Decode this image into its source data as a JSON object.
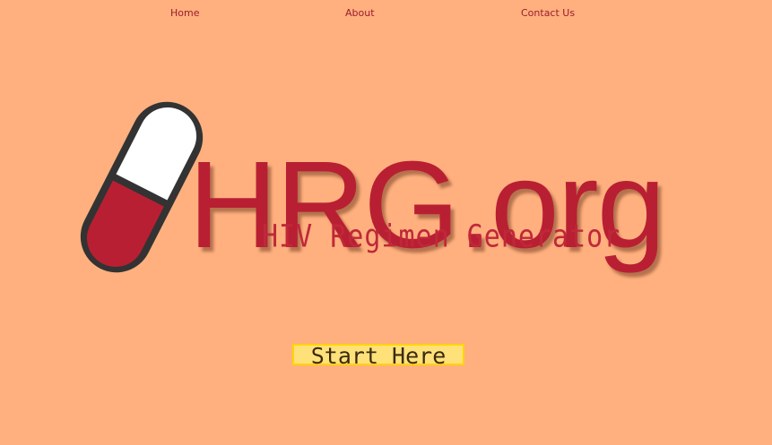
{
  "nav": {
    "home": "Home",
    "about": "About",
    "contact": "Contact Us"
  },
  "logo": {
    "main_text": "HRG.org",
    "tagline": "HIV Regimen Generator",
    "icon": "pill-capsule-icon"
  },
  "start_button": {
    "label": "Start Here"
  },
  "colors": {
    "background": "#FFB07E",
    "brand_red": "#B91F32",
    "button_fill": "#FFE17A",
    "button_border": "#FFD400"
  }
}
